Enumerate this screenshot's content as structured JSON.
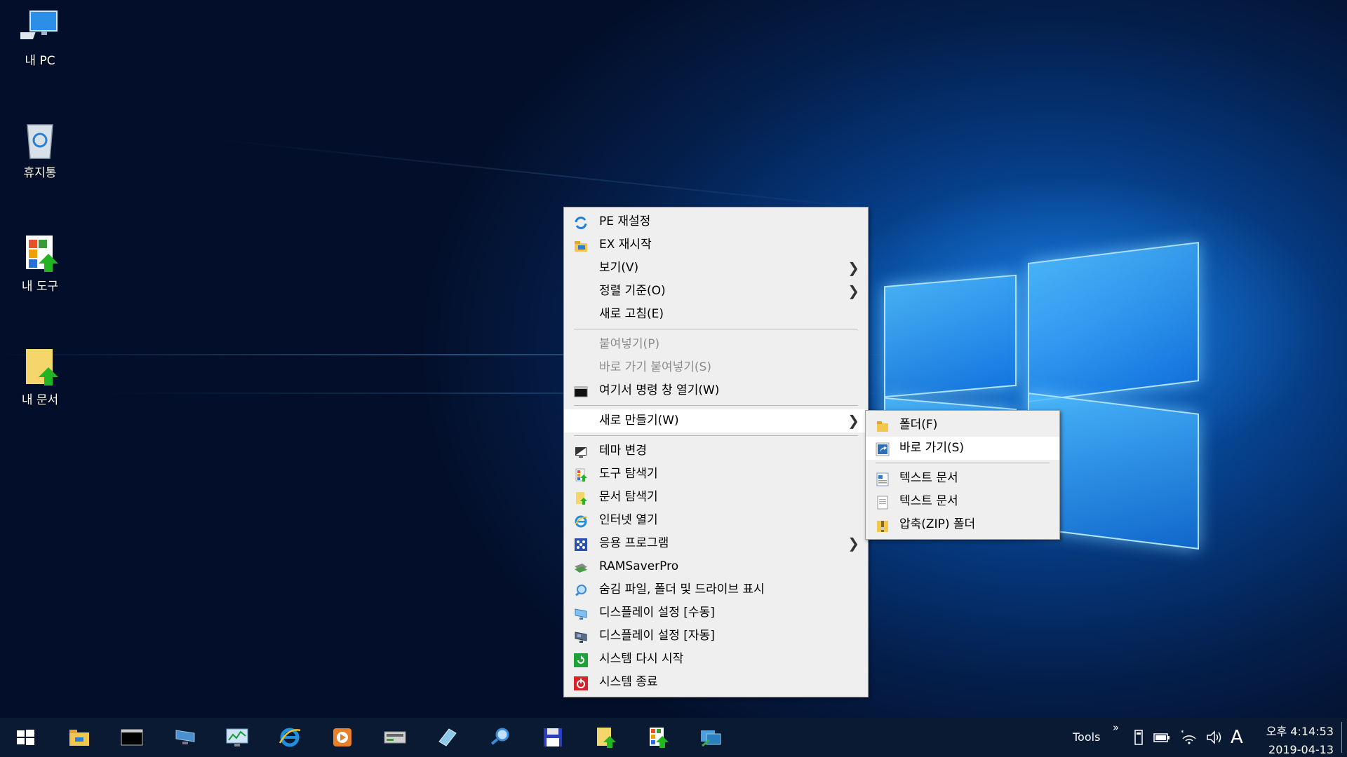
{
  "desktop": {
    "icons": [
      {
        "label": "내 PC",
        "icon": "computer-icon"
      },
      {
        "label": "휴지통",
        "icon": "recycle-bin-icon"
      },
      {
        "label": "내 도구",
        "icon": "tools-shortcut-icon"
      },
      {
        "label": "내 문서",
        "icon": "documents-shortcut-icon"
      }
    ]
  },
  "context_menu": {
    "items": [
      {
        "label": "PE 재설정",
        "icon": "refresh-icon"
      },
      {
        "label": "EX 재시작",
        "icon": "explorer-folder-icon"
      },
      {
        "label": "보기(V)",
        "submenu": true
      },
      {
        "label": "정렬 기준(O)",
        "submenu": true
      },
      {
        "label": "새로 고침(E)"
      },
      {
        "label": "붙여넣기(P)",
        "disabled": true
      },
      {
        "label": "바로 가기 붙여넣기(S)",
        "disabled": true
      },
      {
        "label": "여기서 명령 창 열기(W)",
        "icon": "console-icon"
      },
      {
        "label": "새로 만들기(W)",
        "submenu": true,
        "highlighted": true
      },
      {
        "label": "테마 변경",
        "icon": "theme-icon"
      },
      {
        "label": "도구 탐색기",
        "icon": "tools-icon"
      },
      {
        "label": "문서 탐색기",
        "icon": "document-icon"
      },
      {
        "label": "인터넷 열기",
        "icon": "internet-explorer-icon"
      },
      {
        "label": "응용 프로그램",
        "icon": "apps-icon",
        "submenu": true
      },
      {
        "label": "RAMSaverPro",
        "icon": "ram-icon"
      },
      {
        "label": "숨김 파일, 폴더 및 드라이브 표시",
        "icon": "magnifier-icon"
      },
      {
        "label": "디스플레이 설정 [수동]",
        "icon": "monitor-icon"
      },
      {
        "label": "디스플레이 설정 [자동]",
        "icon": "monitor-auto-icon"
      },
      {
        "label": "시스템 다시 시작",
        "icon": "restart-icon"
      },
      {
        "label": "시스템 종료",
        "icon": "shutdown-icon"
      }
    ]
  },
  "submenu_new": {
    "items": [
      {
        "label": "폴더(F)",
        "icon": "folder-icon"
      },
      {
        "label": "바로 가기(S)",
        "icon": "shortcut-icon"
      },
      {
        "label": "텍스트 문서",
        "icon": "text-document-icon"
      },
      {
        "label": "텍스트 문서",
        "icon": "plain-document-icon"
      },
      {
        "label": "압축(ZIP) 폴더",
        "icon": "zip-folder-icon"
      }
    ]
  },
  "taskbar": {
    "apps": [
      "start-icon",
      "file-explorer-icon",
      "command-prompt-icon",
      "network-icon",
      "resource-monitor-icon",
      "internet-explorer-icon",
      "media-player-icon",
      "drive-icon",
      "eraser-icon",
      "search-user-icon",
      "floppy-save-icon",
      "my-documents-icon",
      "my-tools-icon",
      "remote-desktop-icon"
    ],
    "tools_label": "Tools",
    "overflow": "»",
    "ime": "A",
    "time": "오후 4:14:53",
    "date": "2019-04-13"
  },
  "colors": {
    "menu_bg": "#efefef",
    "taskbar_bg": "#0b1a33",
    "highlight": "#ffffff"
  }
}
